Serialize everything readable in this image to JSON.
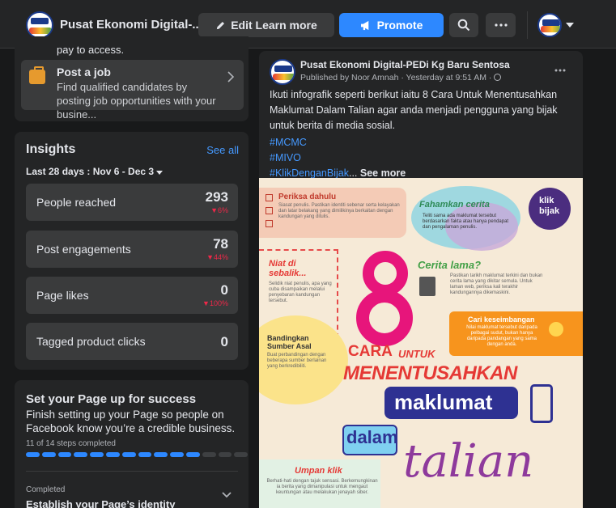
{
  "topbar": {
    "page_name": "Pusat Ekonomi Digital-...",
    "edit_button": "Edit Learn more",
    "promote_button": "Promote"
  },
  "sidebar": {
    "partial_text": "pay to access.",
    "post_job": {
      "title": "Post a job",
      "description": "Find qualified candidates by posting job opportunities with your busine..."
    },
    "insights": {
      "title": "Insights",
      "see_all": "See all",
      "range": "Last 28 days : Nov 6 - Dec 3",
      "rows": [
        {
          "label": "People reached",
          "value": "293",
          "change": "6%"
        },
        {
          "label": "Post engagements",
          "value": "78",
          "change": "44%"
        },
        {
          "label": "Page likes",
          "value": "0",
          "change": "100%"
        },
        {
          "label": "Tagged product clicks",
          "value": "0",
          "change": ""
        }
      ]
    },
    "setup": {
      "title": "Set your Page up for success",
      "description": "Finish setting up your Page so people on Facebook know you’re a credible business.",
      "steps_text": "11 of 14 steps completed",
      "completed_steps": 11,
      "total_steps": 14,
      "completed_label": "Completed",
      "item_title": "Establish your Page’s identity"
    }
  },
  "post": {
    "author": "Pusat Ekonomi Digital-PEDi Kg Baru Sentosa",
    "meta": "Published by Noor Amnah · Yesterday at 9:51 AM ·",
    "body": "Ikuti infografik seperti berikut iaitu 8 Cara Untuk Menentusahkan Maklumat Dalam Talian agar anda menjadi pengguna yang bijak untuk berita di media sosial.",
    "hashtags": [
      "#MCMC",
      "#MIVO",
      "#KlikDenganBijak"
    ],
    "ellipsis": "...",
    "see_more": "See more"
  },
  "infographic": {
    "periksa": "Periksa dahulu",
    "periksa_body": "Siasat penulis. Pastikan identiti sebenar serta kelayakan dan latar belakang yang dimilikinya berkaitan dengan kandungan yang ditulis.",
    "fahamkan": "Fahamkan cerita",
    "fahamkan_body": "Teliti sama ada maklumat tersebut berdasarkan fakta atau hanya pendapat dan pengalaman penulis.",
    "klik_badge_line1": "klik",
    "klik_badge_line2": "bijak",
    "niat": "Niat di sebalik...",
    "niat_body": "Selidik niat penulis, apa yang cuba disampaikan melalui penyebaran kandungan tersebut.",
    "big_number": "8",
    "cerita_lama": "Cerita lama?",
    "cerita_lama_body": "Pastikan tarikh maklumat terkini dan bukan cerita lama yang dikitar semula. Untuk laman web, periksa kali terakhir kandungannya dikemaskini.",
    "cari": "Cari keseimbangan",
    "cari_body": "Nilai maklumat tersebut daripada pelbagai sudut, bukan hanya daripada pandangan yang sama dengan anda.",
    "bandingkan": "Bandingkan Sumber Asal",
    "bandingkan_body": "Buat perbandingan dengan beberapa sumber berlainan yang berkredibiliti.",
    "cara": "CARA",
    "untuk": "UNTUK",
    "menentusahkan": "MENENTUSAHKAN",
    "maklumat": "maklumat",
    "dalam": "dalam",
    "talian": "talian",
    "umpan": "Umpan klik",
    "umpan_body": "Berhati-hati dengan tajuk sensasi. Berkemungkinan ia berita yang dimanipulasi untuk mengaut keuntungan atau melakukan jenayah siber."
  }
}
